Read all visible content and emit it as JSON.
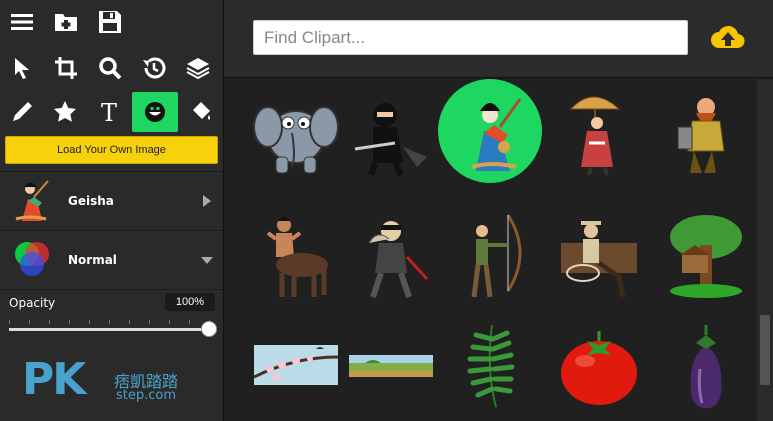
{
  "toolbar": {
    "top": [
      {
        "name": "menu-icon"
      },
      {
        "name": "add-folder-icon"
      },
      {
        "name": "save-icon"
      }
    ],
    "tools_row1": [
      {
        "name": "pointer-icon"
      },
      {
        "name": "crop-icon"
      },
      {
        "name": "zoom-icon"
      },
      {
        "name": "history-icon"
      },
      {
        "name": "layers-icon"
      }
    ],
    "tools_row2": [
      {
        "name": "pencil-icon"
      },
      {
        "name": "star-icon"
      },
      {
        "name": "text-icon"
      },
      {
        "name": "clipart-smiley-icon",
        "active": true
      },
      {
        "name": "fill-bucket-icon"
      }
    ]
  },
  "sidebar": {
    "load_button_label": "Load Your Own Image",
    "clipart_label": "Geisha",
    "blend_label": "Normal",
    "opacity_label": "Opacity",
    "opacity_value": "100%",
    "opacity_fraction": 1.0,
    "watermark": {
      "pk": "PK",
      "cn": "痞凱踏踏",
      "step": "step.com"
    }
  },
  "search": {
    "placeholder": "Find Clipart..."
  },
  "colors": {
    "accent_green": "#1ed760",
    "load_yellow": "#f7d10b",
    "upload_yellow": "#f7c600",
    "panel_bg": "#2a2a2a",
    "gallery_bg": "#202020"
  },
  "gallery": {
    "items": [
      {
        "name": "clipart-elephant"
      },
      {
        "name": "clipart-ninja"
      },
      {
        "name": "clipart-geisha",
        "selected": true
      },
      {
        "name": "clipart-umbrella-woman"
      },
      {
        "name": "clipart-dwarf-warrior"
      },
      {
        "name": "clipart-centaur"
      },
      {
        "name": "clipart-burglar"
      },
      {
        "name": "clipart-archer"
      },
      {
        "name": "clipart-cowboy-lasso"
      },
      {
        "name": "clipart-treehouse"
      },
      {
        "name": "clipart-cherry-blossom"
      },
      {
        "name": "clipart-landscape"
      },
      {
        "name": "clipart-fern-leaf"
      },
      {
        "name": "clipart-tomato"
      },
      {
        "name": "clipart-eggplant"
      }
    ]
  }
}
